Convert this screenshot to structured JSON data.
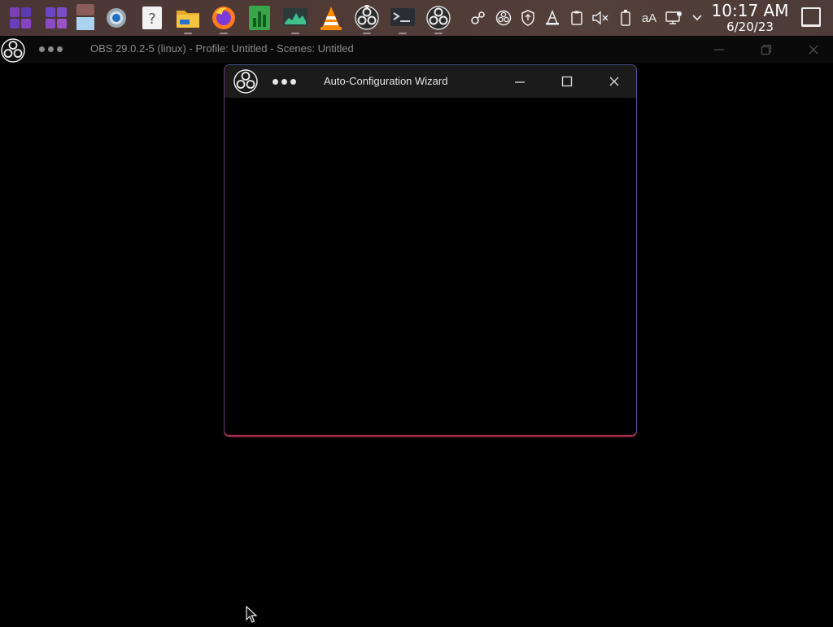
{
  "panel": {
    "tasks": [
      {
        "name": "activities-icon"
      },
      {
        "name": "workspaces-icon"
      },
      {
        "name": "files-preview-icon"
      },
      {
        "name": "settings-gear-icon"
      },
      {
        "name": "help-icon"
      },
      {
        "name": "file-manager-icon"
      },
      {
        "name": "firefox-icon"
      },
      {
        "name": "office-chart-icon"
      },
      {
        "name": "system-monitor-icon"
      },
      {
        "name": "vlc-icon"
      },
      {
        "name": "obs-studio-icon"
      },
      {
        "name": "terminal-icon"
      },
      {
        "name": "obs-studio-icon-2"
      }
    ],
    "tray": [
      {
        "name": "network-share-icon"
      },
      {
        "name": "obs-tray-icon"
      },
      {
        "name": "security-shield-icon"
      },
      {
        "name": "vlc-tray-icon"
      },
      {
        "name": "clipboard-icon"
      },
      {
        "name": "volume-muted-icon"
      },
      {
        "name": "battery-icon"
      },
      {
        "name": "font-size-icon"
      },
      {
        "name": "display-settings-icon"
      },
      {
        "name": "tray-expand-chevron-icon"
      }
    ],
    "font_size_label": "aA",
    "clock": {
      "time": "10:17 AM",
      "date": "6/20/23"
    }
  },
  "obs_window": {
    "title": "OBS 29.0.2-5 (linux) - Profile: Untitled - Scenes: Untitled"
  },
  "wizard": {
    "title": "Auto-Configuration Wizard"
  },
  "colors": {
    "panel_bg": "#4f3a35",
    "titlebar_bg": "#1b1b1b",
    "desktop_bg": "#000000",
    "dot_red": "#e05a5a",
    "dot_yellow": "#e7c34b",
    "dot_green": "#5ac25a"
  }
}
